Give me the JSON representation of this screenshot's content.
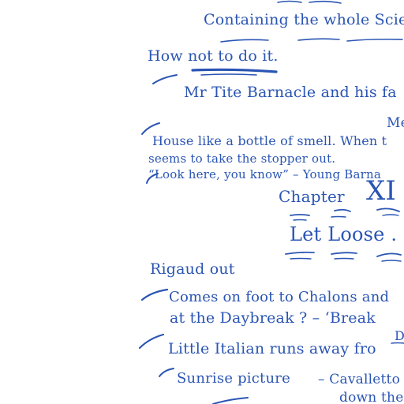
{
  "manuscript": {
    "lines": [
      {
        "id": "l1",
        "text": "Containing the whole Scie"
      },
      {
        "id": "l2",
        "text": "How not to do it."
      },
      {
        "id": "l3",
        "text": "Mr Tite Barnacle and his fa"
      },
      {
        "id": "l4",
        "text": "Me"
      },
      {
        "id": "l5",
        "text": "House like a bottle of smell.  When t"
      },
      {
        "id": "l6",
        "text": "seems to take the stopper out."
      },
      {
        "id": "l7",
        "text": "“Look here, you know” – Young Barna"
      },
      {
        "id": "l8a",
        "text": "Chapter"
      },
      {
        "id": "l8b",
        "text": "XI"
      },
      {
        "id": "l9",
        "text": "Let Loose ."
      },
      {
        "id": "l10",
        "text": "Rigaud out"
      },
      {
        "id": "l11",
        "text": "Comes on foot to Chalons and"
      },
      {
        "id": "l12",
        "text": "at the Daybreak  ? –  ‘Break"
      },
      {
        "id": "l13",
        "text": "Little Italian runs away  fro"
      },
      {
        "id": "l13b",
        "text": "D"
      },
      {
        "id": "l14",
        "text": "Sunrise picture"
      },
      {
        "id": "l14b",
        "text": "– Cavalletto"
      },
      {
        "id": "l15",
        "text": "down the"
      }
    ]
  },
  "colors": {
    "ink": "#2a55b3",
    "paper": "#ffffff"
  }
}
